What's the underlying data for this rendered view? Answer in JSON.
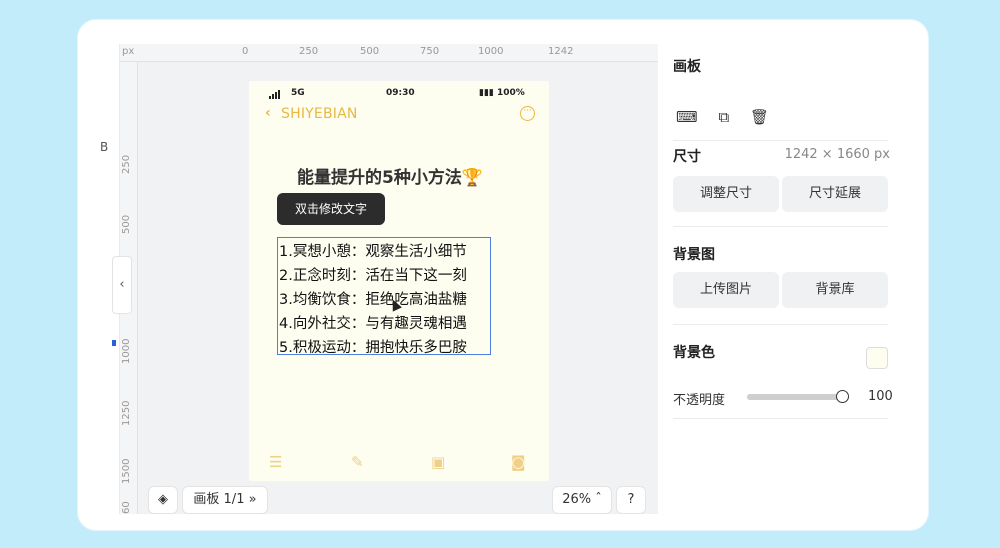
{
  "ruler": {
    "unit": "px",
    "top_ticks": [
      "0",
      "250",
      "500",
      "750",
      "1000",
      "1242"
    ],
    "left_ticks": [
      "250",
      "500",
      "1000",
      "1250",
      "1500",
      "60"
    ]
  },
  "left_strip": {
    "letter": "B"
  },
  "phone": {
    "status": {
      "network": "5G",
      "time": "09:30",
      "battery": "100%"
    },
    "nav_title": "SHIYEBIAN",
    "headline": "能量提升的5种小方法🏆",
    "tooltip": "双击修改文字",
    "lines": [
      "1.冥想小憩：观察生活小细节",
      "2.正念时刻：活在当下这一刻",
      "3.均衡饮食：拒绝吃高油盐糖",
      "4.向外社交：与有趣灵魂相遇",
      "5.积极运动：拥抱快乐多巴胺"
    ],
    "accent": "#e8b845",
    "background": "#fdfdf0"
  },
  "bottom": {
    "artboard_label": "画板 1/1",
    "expand": "»",
    "zoom": "26%",
    "help": "?"
  },
  "panel": {
    "artboard_title": "画板",
    "size_title": "尺寸",
    "size_value": "1242 × 1660 px",
    "resize_button": "调整尺寸",
    "extend_button": "尺寸延展",
    "bg_image_title": "背景图",
    "upload_button": "上传图片",
    "library_button": "背景库",
    "bg_color_title": "背景色",
    "bg_color": "#fdfdf0",
    "opacity_label": "不透明度",
    "opacity_value": "100",
    "opacity_fraction": 1.0
  }
}
